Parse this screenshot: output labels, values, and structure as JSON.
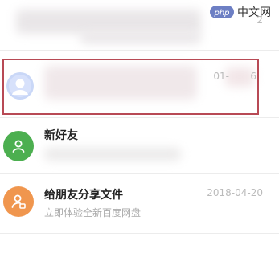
{
  "watermark": {
    "logo_text": "php",
    "site_text": "中文网"
  },
  "rows": [
    {
      "title": "",
      "date": "2"
    },
    {
      "title": "",
      "date": "01-",
      "date_suffix": "6"
    },
    {
      "title": "新好友",
      "subtitle": "",
      "avatar_color": "#4caf50"
    },
    {
      "title": "给朋友分享文件",
      "subtitle": "立即体验全新百度网盘",
      "date": "2018-04-20",
      "avatar_color": "#f0964e"
    }
  ],
  "colors": {
    "highlight_border": "#b84a55",
    "default_avatar": "#c9d7f7"
  }
}
